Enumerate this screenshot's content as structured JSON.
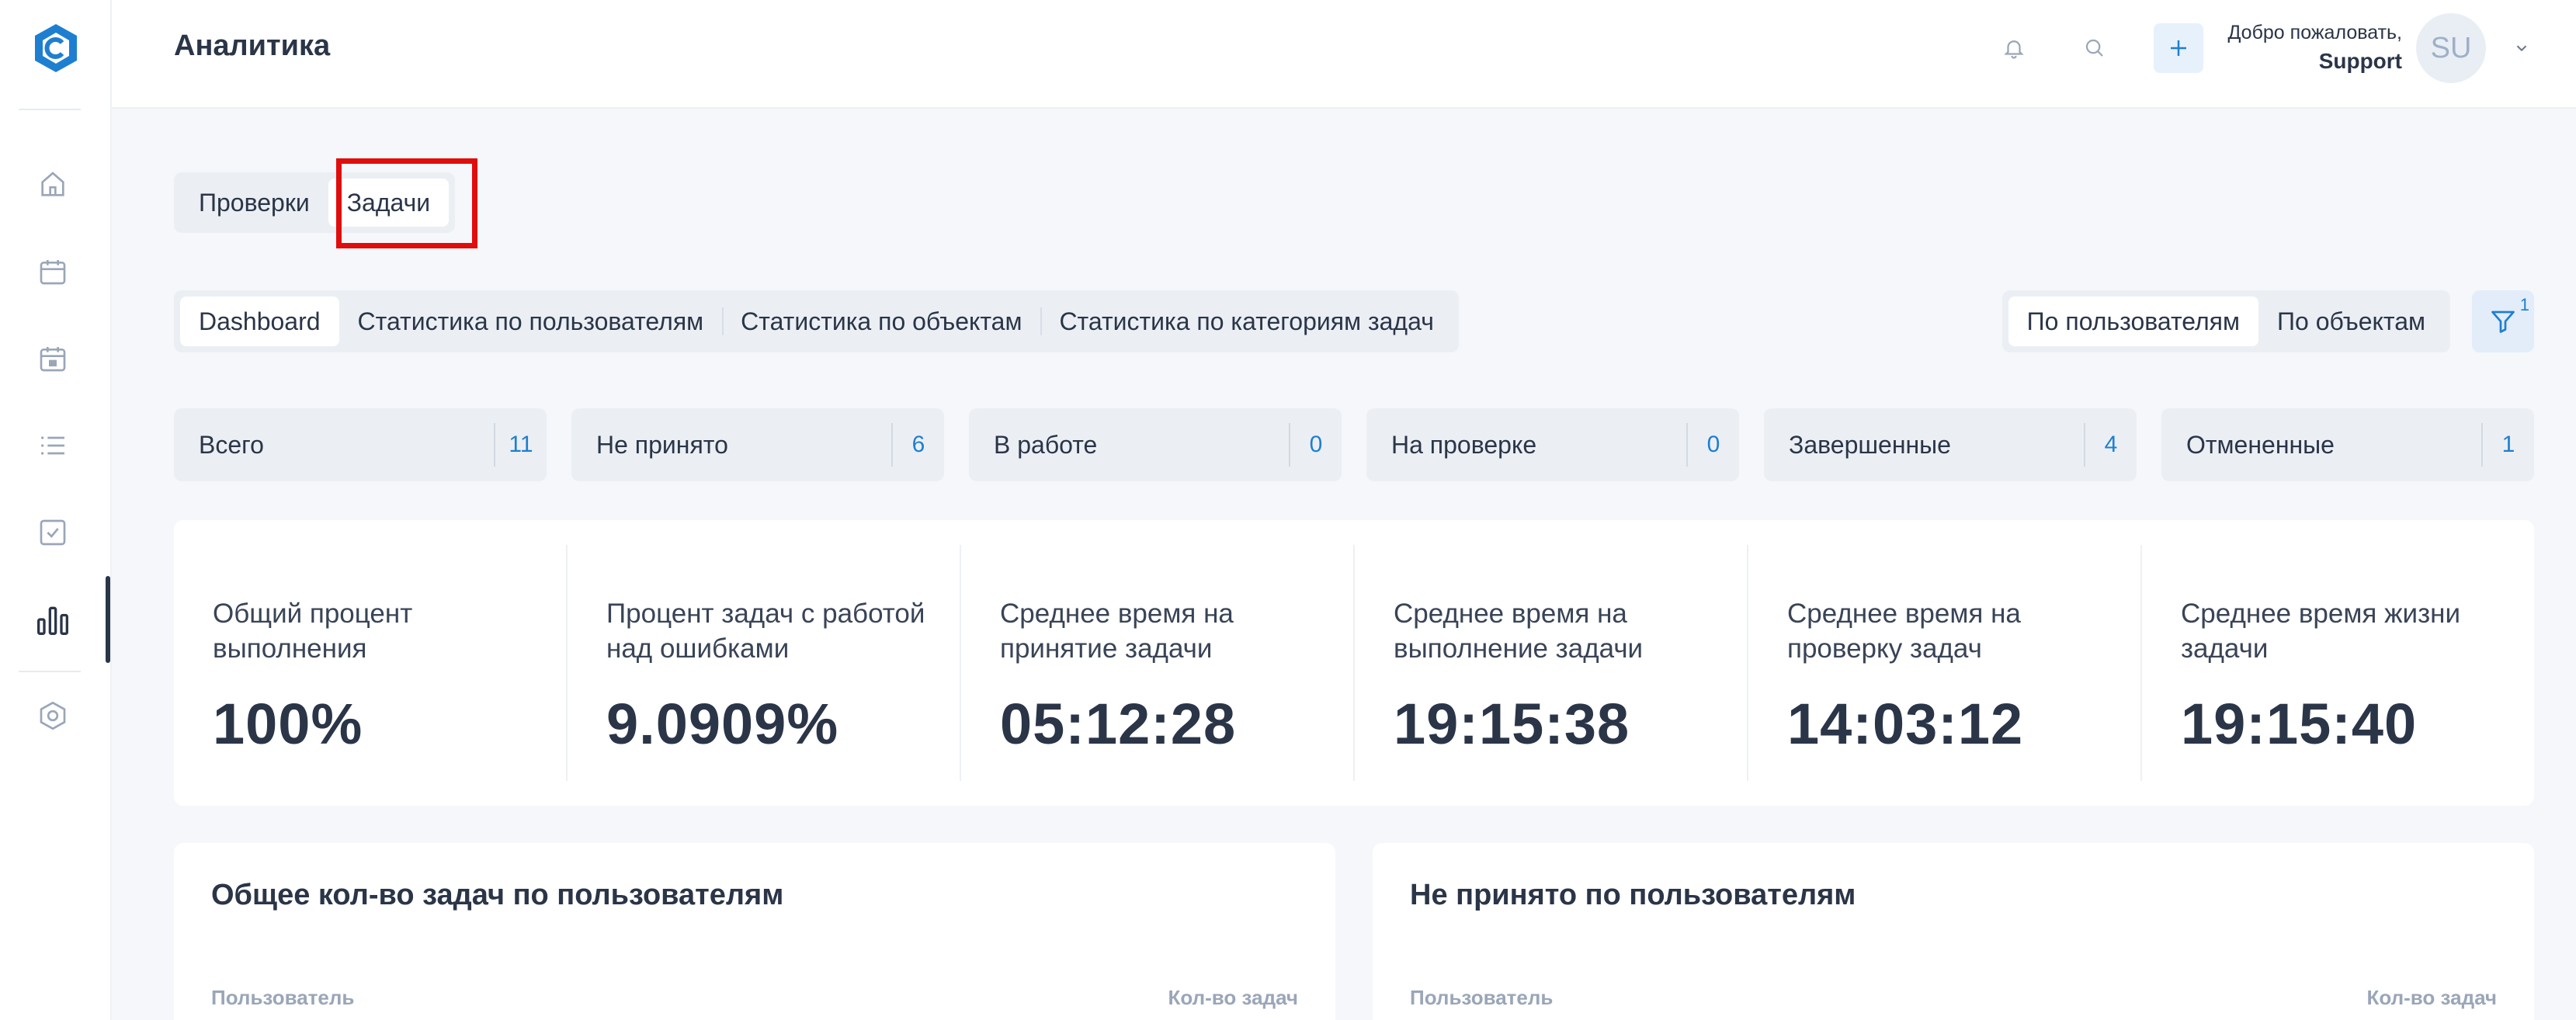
{
  "colors": {
    "accent": "#1e7fd1",
    "text": "#2b3548",
    "highlight": "#e00d0d",
    "logo": "#1e7fd1"
  },
  "sidebar": {
    "logo": "logo-icon",
    "items": [
      {
        "icon": "home-icon"
      },
      {
        "icon": "calendar-icon"
      },
      {
        "icon": "calendar-event-icon"
      },
      {
        "icon": "list-icon"
      },
      {
        "icon": "checkbox-icon"
      },
      {
        "icon": "bar-chart-icon",
        "active": true
      },
      {
        "icon": "settings-hex-icon"
      }
    ]
  },
  "header": {
    "title": "Аналитика",
    "welcome": "Добро пожаловать,",
    "user_name": "Support",
    "avatar_initials": "SU"
  },
  "tabs_primary": {
    "items": [
      "Проверки",
      "Задачи"
    ],
    "active": "Задачи"
  },
  "tabs_secondary": {
    "items": [
      "Dashboard",
      "Статистика по пользователям",
      "Статистика по объектам",
      "Статистика по категориям задач"
    ],
    "active": "Dashboard"
  },
  "view_toggle": {
    "items": [
      "По пользователям",
      "По объектам"
    ],
    "active": "По пользователям"
  },
  "filter": {
    "count": "1"
  },
  "counters": [
    {
      "label": "Всего",
      "value": "11"
    },
    {
      "label": "Не принято",
      "value": "6"
    },
    {
      "label": "В работе",
      "value": "0"
    },
    {
      "label": "На проверке",
      "value": "0"
    },
    {
      "label": "Завершенные",
      "value": "4"
    },
    {
      "label": "Отмененные",
      "value": "1"
    }
  ],
  "stats": [
    {
      "label": "Общий процент выполнения",
      "value": "100%"
    },
    {
      "label": "Процент задач с работой над ошибками",
      "value": "9.0909%"
    },
    {
      "label": "Среднее время на принятие задачи",
      "value": "05:12:28"
    },
    {
      "label": "Среднее время на выполнение задачи",
      "value": "19:15:38"
    },
    {
      "label": "Среднее время на проверку задач",
      "value": "14:03:12"
    },
    {
      "label": "Среднее время жизни задачи",
      "value": "19:15:40"
    }
  ],
  "panels": [
    {
      "title": "Общее кол-во задач по пользователям",
      "col_left": "Пользователь",
      "col_right": "Кол-во задач"
    },
    {
      "title": "Не принято по пользователям",
      "col_left": "Пользователь",
      "col_right": "Кол-во задач"
    }
  ]
}
